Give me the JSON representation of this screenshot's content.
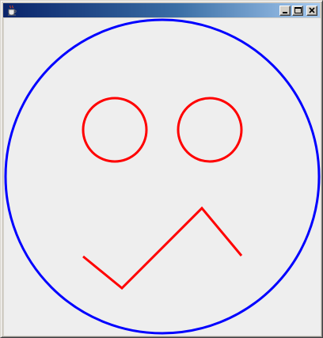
{
  "window": {
    "title": "",
    "icon": "java-cup-icon",
    "controls": {
      "minimize": "minimize-icon",
      "maximize": "maximize-icon",
      "close": "close-icon"
    }
  },
  "drawing": {
    "face_color": "#0000ff",
    "feature_color": "#ff0000",
    "background": "#eeeeee"
  }
}
